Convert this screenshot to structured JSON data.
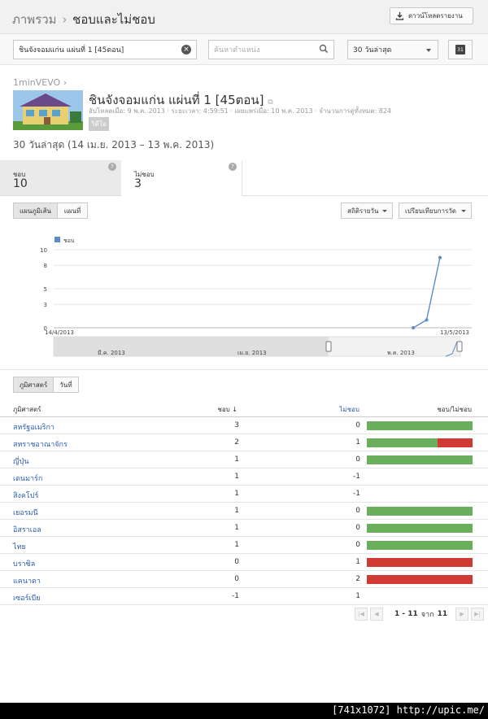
{
  "header": {
    "breadcrumb_root": "ภาพรวม",
    "breadcrumb_sep": "›",
    "breadcrumb_current": "ชอบและไม่ชอบ",
    "download_label": "ดาวน์โหลดรายงาน"
  },
  "filters": {
    "content_value": "ชินจังจอมแก่น แผ่นที่ 1 [45ตอน]",
    "location_placeholder": "ค้นหาตำแหน่ง",
    "period_value": "30 วันล่าสุด",
    "calendar_label": "31"
  },
  "video": {
    "channel": "1minVEVO ›",
    "title": "ชินจังจอมแก่น แผ่นที่ 1 [45ตอน]",
    "meta": "อัปโหลดเมื่อ: 9 พ.ค. 2013 · ระยะเวลา: 4:59:51 · เผยแพร่เมื่อ: 10 พ.ค. 2013 · จำนวนการดูทั้งหมด: 824",
    "badge": "วิดีโอ"
  },
  "date_range": "30 วันล่าสุด (14 เม.ย. 2013 – 13 พ.ค. 2013)",
  "metrics": [
    {
      "label": "ชอบ",
      "value": "10"
    },
    {
      "label": "ไม่ชอบ",
      "value": "3"
    }
  ],
  "chart_toolbar": {
    "toggle_line": "แผนภูมิเส้น",
    "toggle_map": "แผนที่",
    "daily_stats": "สถิติรายวัน",
    "compare": "เปรียบเทียบการวัด"
  },
  "chart_data": {
    "type": "line",
    "legend": [
      "ชอบ"
    ],
    "series": [
      {
        "name": "ชอบ",
        "x": [
          "14/4/2013",
          "...",
          "10/5/2013",
          "11/5/2013",
          "12/5/2013",
          "13/5/2013"
        ],
        "values": [
          0,
          0,
          0,
          0,
          1,
          9
        ]
      }
    ],
    "y_ticks": [
      "10",
      "8",
      "5",
      "3",
      "0"
    ],
    "ylim": [
      0,
      10
    ],
    "x_start_label": "14/4/2013",
    "x_end_label": "13/5/2013",
    "navigator_labels": [
      "มี.ค. 2013",
      "เม.ย. 2013",
      "พ.ค. 2013"
    ],
    "accent": "#5b8bc9"
  },
  "table": {
    "tabs": [
      "ภูมิศาสตร์",
      "วันที่"
    ],
    "headers": {
      "country": "ภูมิศาสตร์",
      "likes": "ชอบ ↓",
      "dislikes": "ไม่ชอบ",
      "ratio": "ชอบ/ไม่ชอบ"
    },
    "rows": [
      {
        "country": "สหรัฐอเมริกา",
        "likes": "3",
        "dislikes": "0",
        "like_share": 1.0
      },
      {
        "country": "สหราชอาณาจักร",
        "likes": "2",
        "dislikes": "1",
        "like_share": 0.667
      },
      {
        "country": "ญี่ปุ่น",
        "likes": "1",
        "dislikes": "0",
        "like_share": 1.0
      },
      {
        "country": "เดนมาร์ก",
        "likes": "1",
        "dislikes": "-1",
        "like_share": null
      },
      {
        "country": "สิงคโปร์",
        "likes": "1",
        "dislikes": "-1",
        "like_share": null
      },
      {
        "country": "เยอรมนี",
        "likes": "1",
        "dislikes": "0",
        "like_share": 1.0
      },
      {
        "country": "อิสราเอล",
        "likes": "1",
        "dislikes": "0",
        "like_share": 1.0
      },
      {
        "country": "ไทย",
        "likes": "1",
        "dislikes": "0",
        "like_share": 1.0
      },
      {
        "country": "บราซิล",
        "likes": "0",
        "dislikes": "1",
        "like_share": 0.0
      },
      {
        "country": "แคนาดา",
        "likes": "0",
        "dislikes": "2",
        "like_share": 0.0
      },
      {
        "country": "เซอร์เบีย",
        "likes": "-1",
        "dislikes": "1",
        "like_share": null
      }
    ],
    "colors": {
      "like": "#6aaf5c",
      "dislike": "#d13a32"
    }
  },
  "pager": {
    "range": "1 - 11",
    "of": "จาก",
    "total": "11"
  },
  "watermark": "[741x1072] http://upic.me/"
}
